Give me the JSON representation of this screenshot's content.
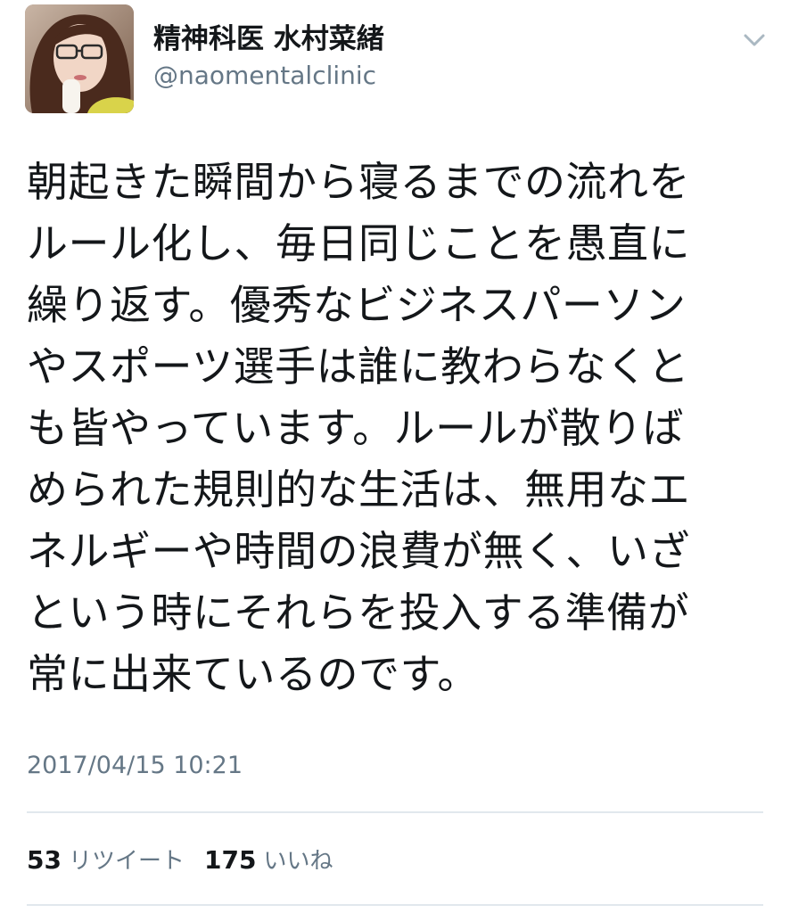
{
  "user": {
    "display_name": "精神科医 水村菜緒",
    "handle": "@naomentalclinic"
  },
  "tweet": {
    "text": "朝起きた瞬間から寝るまでの流れを\nルール化し、毎日同じことを愚直に\n繰り返す。優秀なビジネスパーソン\nやスポーツ選手は誰に教わらなくと\nも皆やっています。ルールが散りば\nめられた規則的な生活は、無用なエ\nネルギーや時間の浪費が無く、いざ\nという時にそれらを投入する準備が\n常に出来ているのです。",
    "timestamp": "2017/04/15 10:21"
  },
  "stats": {
    "retweet_count": "53",
    "retweet_label": "リツイート",
    "like_count": "175",
    "like_label": "いいね"
  },
  "icons": {
    "menu": "chevron-down-icon",
    "avatar": "profile-photo"
  },
  "colors": {
    "text_primary": "#14171a",
    "text_secondary": "#657786",
    "divider": "#e1e8ed"
  }
}
